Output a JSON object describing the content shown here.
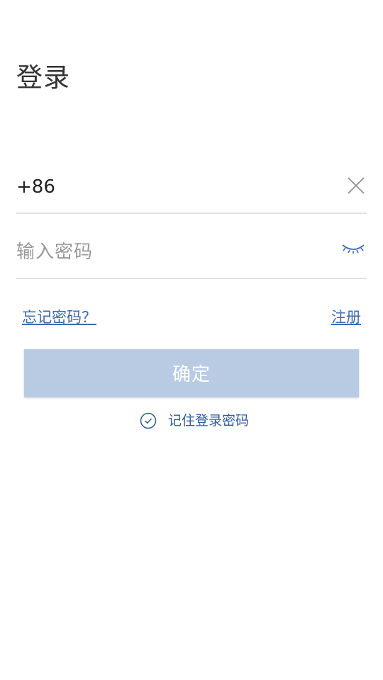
{
  "page": {
    "title": "登录"
  },
  "phone_field": {
    "value": "+86",
    "clear_icon": "close-icon"
  },
  "password_field": {
    "placeholder": "输入密码",
    "visibility_icon": "eye-closed-icon"
  },
  "links": {
    "forgot_password": "忘记密码？",
    "register": "注册"
  },
  "confirm_button": {
    "label": "确定",
    "state": "disabled"
  },
  "remember": {
    "label": "记住登录密码",
    "checked": true,
    "icon": "check-circle-icon"
  },
  "colors": {
    "accent": "#3f6aad",
    "button_disabled": "#b8cbe3",
    "divider": "#e2e2e2"
  }
}
